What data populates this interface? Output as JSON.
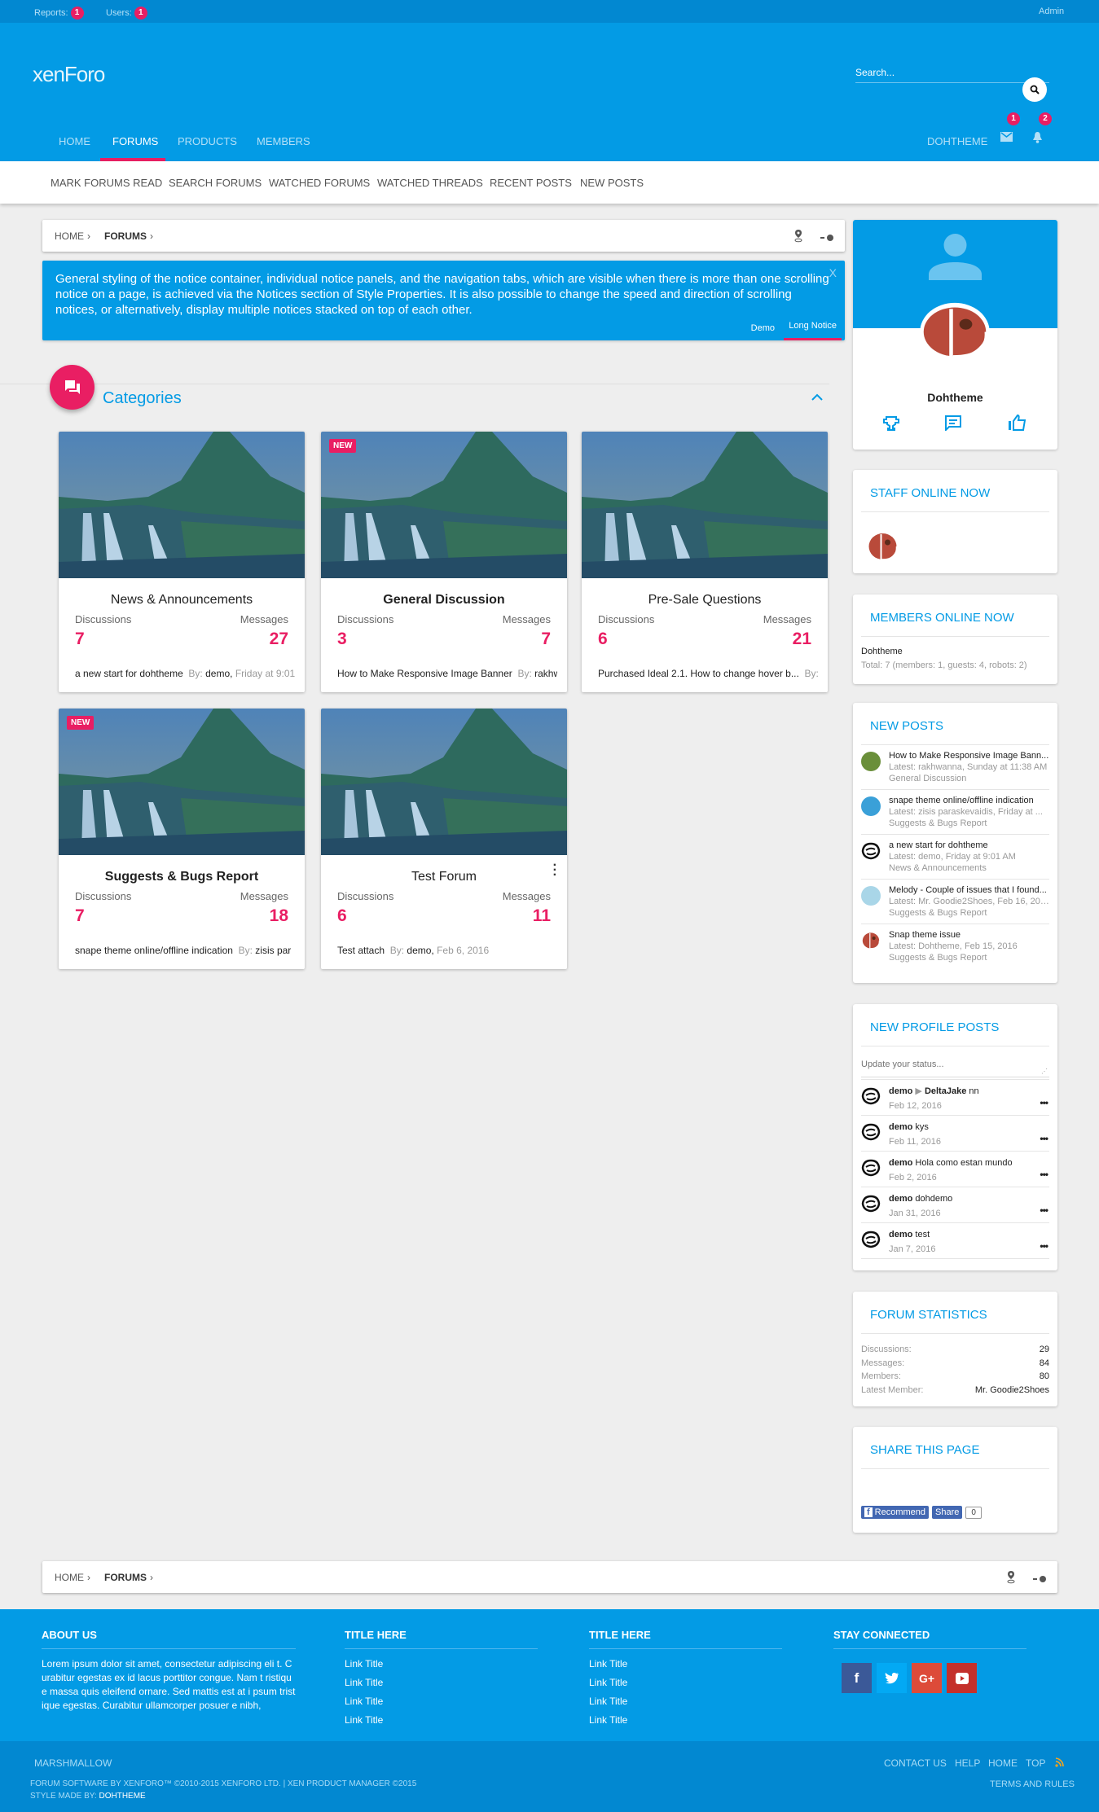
{
  "topbar": {
    "reports_label": "Reports:",
    "reports_count": "1",
    "users_label": "Users:",
    "users_count": "1",
    "admin": "Admin"
  },
  "header": {
    "logo": "xenForo",
    "search_placeholder": "Search...",
    "user": "DOHTHEME",
    "inbox_count": "1",
    "alerts_count": "2"
  },
  "nav": {
    "tabs": [
      {
        "label": "HOME"
      },
      {
        "label": "FORUMS",
        "active": true
      },
      {
        "label": "PRODUCTS"
      },
      {
        "label": "MEMBERS"
      }
    ]
  },
  "subnav": [
    "MARK FORUMS READ",
    "SEARCH FORUMS",
    "WATCHED FORUMS",
    "WATCHED THREADS",
    "RECENT POSTS",
    "NEW POSTS"
  ],
  "breadcrumb": {
    "home": "HOME",
    "forums": "FORUMS"
  },
  "notice": {
    "text": "General styling of the notice container, individual notice panels, and the navigation tabs, which are visible when there is more than one scrolling notice on a page, is achieved via the Notices section of Style Properties. It is also possible to change the speed and direction of scrolling notices, or alternatively, display multiple notices stacked on top of each other.",
    "close": "X",
    "tabs": [
      "Demo",
      "Long Notice"
    ]
  },
  "categories": {
    "title": "Categories",
    "disc_label": "Discussions",
    "msg_label": "Messages",
    "new_label": "NEW",
    "by_label": "By:",
    "forums": [
      {
        "title": "News & Announcements",
        "discussions": "7",
        "messages": "27",
        "last_title": "a new start for dohtheme",
        "last_user": "demo,",
        "last_date": "Friday at 9:01",
        "new": false,
        "bold": false
      },
      {
        "title": "General Discussion",
        "discussions": "3",
        "messages": "7",
        "last_title": "How to Make Responsive Image Banner",
        "last_user": "rakhw",
        "last_date": "",
        "new": true,
        "bold": true
      },
      {
        "title": "Pre-Sale Questions",
        "discussions": "6",
        "messages": "21",
        "last_title": "Purchased Ideal 2.1. How to change hover b...",
        "last_user": "",
        "last_date": "",
        "new": false,
        "bold": false
      },
      {
        "title": "Suggests & Bugs Report",
        "discussions": "7",
        "messages": "18",
        "last_title": "snape theme online/offline indication",
        "last_user": "zisis par",
        "last_date": "",
        "new": true,
        "bold": true
      },
      {
        "title": "Test Forum",
        "discussions": "6",
        "messages": "11",
        "last_title": "Test attach",
        "last_user": "demo,",
        "last_date": "Feb 6, 2016",
        "new": false,
        "bold": false
      }
    ]
  },
  "profile": {
    "name": "Dohtheme"
  },
  "staff": {
    "title": "STAFF ONLINE NOW"
  },
  "members_online": {
    "title": "MEMBERS ONLINE NOW",
    "list": "Dohtheme",
    "total": "Total: 7 (members: 1, guests: 4, robots: 2)"
  },
  "new_posts": {
    "title": "NEW POSTS",
    "items": [
      {
        "title": "How to Make Responsive Image Bann...",
        "latest": "Latest: rakhwanna, Sunday at 11:38 AM",
        "forum": "General Discussion",
        "avatar": "#6a8f3a"
      },
      {
        "title": "snape theme online/offline indication",
        "latest": "Latest: zisis paraskevaidis, Friday at ...",
        "forum": "Suggests & Bugs Report",
        "avatar": "#3aa0d8"
      },
      {
        "title": "a new start for dohtheme",
        "latest": "Latest: demo, Friday at 9:01 AM",
        "forum": "News & Announcements",
        "avatar": "#111111"
      },
      {
        "title": "Melody - Couple of issues that I found...",
        "latest": "Latest: Mr. Goodie2Shoes, Feb 16, 2016",
        "forum": "Suggests & Bugs Report",
        "avatar": "#a9d6e8"
      },
      {
        "title": "Snap theme issue",
        "latest": "Latest: Dohtheme, Feb 15, 2016",
        "forum": "Suggests & Bugs Report",
        "avatar": "#b94a3a"
      }
    ]
  },
  "profile_posts": {
    "title": "NEW PROFILE POSTS",
    "placeholder": "Update your status...",
    "items": [
      {
        "user": "demo",
        "target": "DeltaJake",
        "text": "nn",
        "date": "Feb 12, 2016"
      },
      {
        "user": "demo",
        "target": "",
        "text": "kys",
        "date": "Feb 11, 2016"
      },
      {
        "user": "demo",
        "target": "",
        "text": "Hola como estan mundo",
        "date": "Feb 2, 2016"
      },
      {
        "user": "demo",
        "target": "",
        "text": "dohdemo",
        "date": "Jan 31, 2016"
      },
      {
        "user": "demo",
        "target": "",
        "text": "test",
        "date": "Jan 7, 2016"
      }
    ]
  },
  "stats": {
    "title": "FORUM STATISTICS",
    "rows": [
      {
        "label": "Discussions:",
        "value": "29"
      },
      {
        "label": "Messages:",
        "value": "84"
      },
      {
        "label": "Members:",
        "value": "80"
      },
      {
        "label": "Latest Member:",
        "value": "Mr. Goodie2Shoes"
      }
    ]
  },
  "share": {
    "title": "SHARE THIS PAGE",
    "recommend": "Recommend",
    "share": "Share",
    "count": "0"
  },
  "footer": {
    "about_title": "ABOUT US",
    "about_text": "Lorem ipsum dolor sit amet, consectetur adipiscing eli t. Curabitur egestas ex id lacus porttitor congue. Nam t ristique massa quis eleifend ornare. Sed mattis est at i psum tristique egestas. Curabitur ullamcorper posuer e nibh,",
    "col2_title": "TITLE HERE",
    "col3_title": "TITLE HERE",
    "links": [
      "Link Title",
      "Link Title",
      "Link Title",
      "Link Title"
    ],
    "social_title": "STAY CONNECTED",
    "style_name": "MARSHMALLOW",
    "bottom_links": [
      "CONTACT US",
      "HELP",
      "HOME",
      "TOP"
    ],
    "copyright": "FORUM SOFTWARE BY XENFORO™ ©2010-2015 XENFORO LTD. | XEN PRODUCT MANAGER ©2015",
    "style_by": "STYLE MADE BY:",
    "style_author": "DOHTHEME",
    "terms": "TERMS AND RULES"
  },
  "colors": {
    "primary": "#039be5",
    "primary_dark": "#0288d1",
    "accent": "#e91e63"
  }
}
